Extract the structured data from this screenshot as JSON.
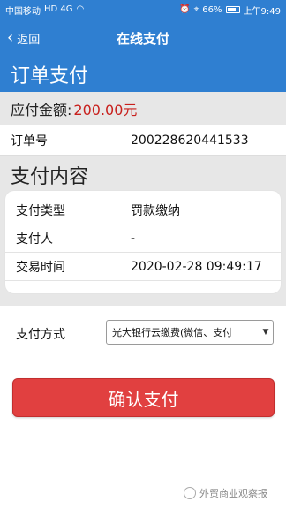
{
  "statusbar": {
    "carrier": "中国移动",
    "carrier_badges": "HD 4G",
    "battery_percent": "66%",
    "time": "上午9:49"
  },
  "nav": {
    "back_label": "返回",
    "title": "在线支付"
  },
  "order_section": {
    "heading": "订单支付",
    "amount_label": "应付金额:",
    "amount_value": "200.00元",
    "order_no_label": "订单号",
    "order_no_value": "200228620441533"
  },
  "content_section": {
    "heading": "支付内容",
    "rows": [
      {
        "label": "支付类型",
        "value": "罚款缴纳"
      },
      {
        "label": "支付人",
        "value": "-"
      },
      {
        "label": "交易时间",
        "value": "2020-02-28 09:49:17"
      }
    ]
  },
  "payment": {
    "label": "支付方式",
    "selected_option": "光大银行云缴费(微信、支付"
  },
  "confirm_button": "确认支付",
  "watermark": "外贸商业观察报",
  "colors": {
    "brand_blue": "#2f7fd1",
    "amount_red": "#c8201d",
    "button_red": "#e14040"
  }
}
